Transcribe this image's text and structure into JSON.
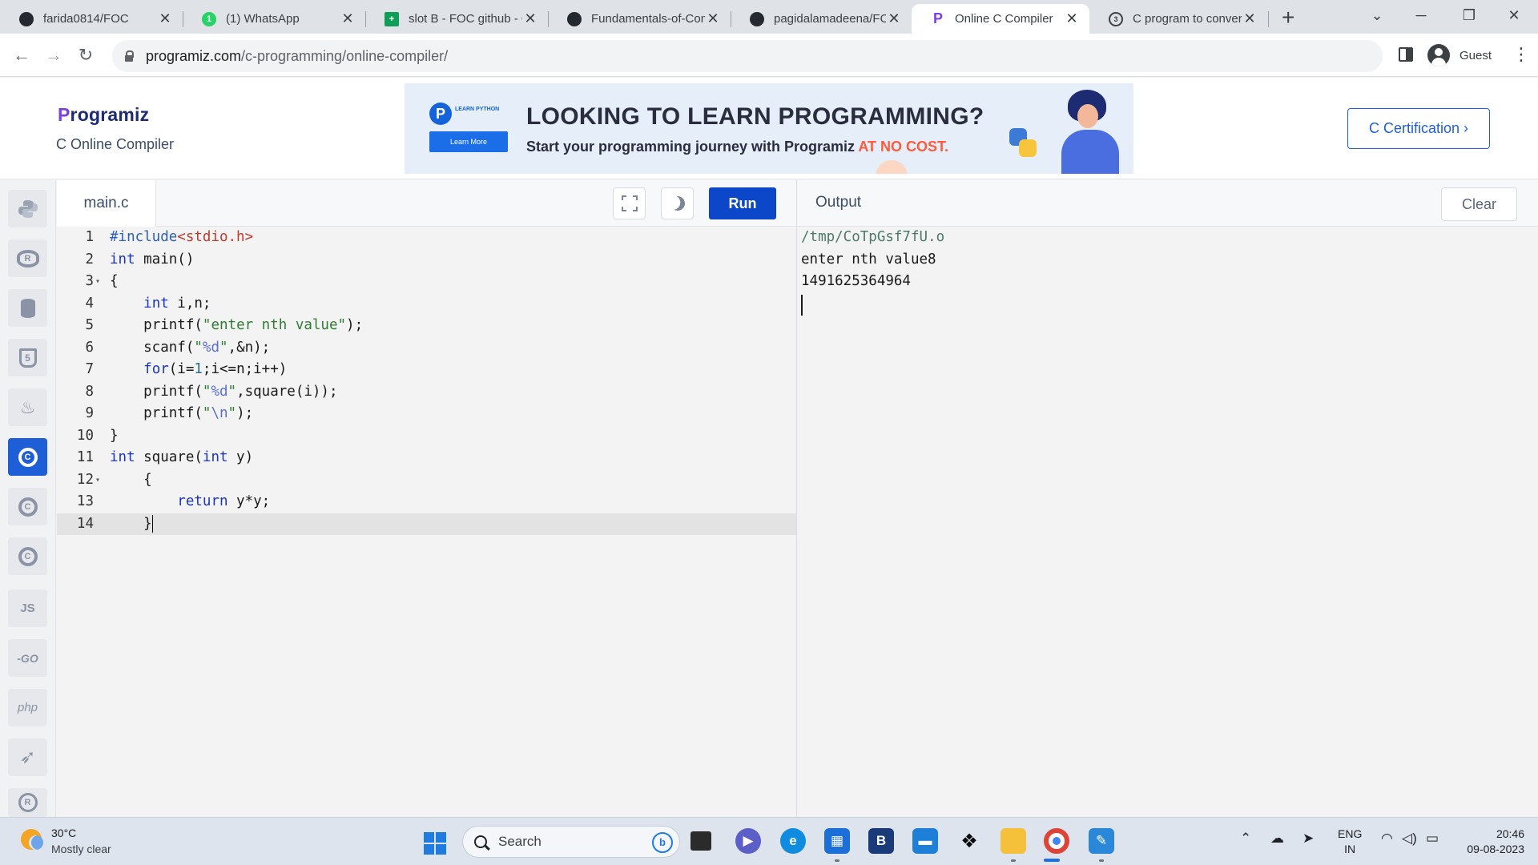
{
  "browser": {
    "tabs": [
      {
        "title": "farida0814/FOC",
        "icon": "github-icon",
        "active": false
      },
      {
        "title": "(1) WhatsApp",
        "icon": "whatsapp-icon",
        "active": false
      },
      {
        "title": "slot B - FOC github - G",
        "icon": "sheets-icon",
        "active": false
      },
      {
        "title": "Fundamentals-of-Com",
        "icon": "github-icon",
        "active": false
      },
      {
        "title": "pagidalamadeena/FOC",
        "icon": "github-icon",
        "active": false
      },
      {
        "title": "Online C Compiler",
        "icon": "programiz-icon",
        "active": true
      },
      {
        "title": "C program to convert",
        "icon": "site-icon",
        "active": false
      }
    ],
    "url_host": "programiz.com",
    "url_path": "/c-programming/online-compiler/",
    "profile_label": "Guest"
  },
  "site": {
    "logo": "rogramiz",
    "logo_p": "P",
    "subtitle": "C Online Compiler",
    "banner": {
      "tag": "LEARN PYTHON",
      "learn_more": "Learn More",
      "headline": "LOOKING TO LEARN PROGRAMMING?",
      "tagline": "Start your programming journey with Programiz ",
      "tagline_highlight": "AT NO COST."
    },
    "cert_button": "C Certification ›"
  },
  "languages": [
    {
      "name": "python-lang-icon",
      "label": ""
    },
    {
      "name": "r-lang-icon",
      "label": "R"
    },
    {
      "name": "sql-lang-icon",
      "label": ""
    },
    {
      "name": "html-lang-icon",
      "label": "5"
    },
    {
      "name": "java-lang-icon",
      "label": "♨"
    },
    {
      "name": "c-lang-icon",
      "label": "C",
      "active": true
    },
    {
      "name": "cpp-lang-icon",
      "label": "C"
    },
    {
      "name": "csharp-lang-icon",
      "label": "C"
    },
    {
      "name": "js-lang-icon",
      "label": "JS"
    },
    {
      "name": "go-lang-icon",
      "label": "-GO"
    },
    {
      "name": "php-lang-icon",
      "label": "php"
    },
    {
      "name": "swift-lang-icon",
      "label": "➶"
    },
    {
      "name": "rust-lang-icon",
      "label": "R"
    }
  ],
  "editor": {
    "filename": "main.c",
    "run_label": "Run",
    "lines": [
      {
        "n": "1",
        "text": "#include<stdio.h>",
        "fold": ""
      },
      {
        "n": "2",
        "text": "int main()",
        "fold": ""
      },
      {
        "n": "3",
        "text": "{",
        "fold": "▾"
      },
      {
        "n": "4",
        "text": "    int i,n;",
        "fold": ""
      },
      {
        "n": "5",
        "text": "    printf(\"enter nth value\");",
        "fold": ""
      },
      {
        "n": "6",
        "text": "    scanf(\"%d\",&n);",
        "fold": ""
      },
      {
        "n": "7",
        "text": "    for(i=1;i<=n;i++)",
        "fold": ""
      },
      {
        "n": "8",
        "text": "    printf(\"%d\",square(i));",
        "fold": ""
      },
      {
        "n": "9",
        "text": "    printf(\"\\n\");",
        "fold": ""
      },
      {
        "n": "10",
        "text": "}",
        "fold": ""
      },
      {
        "n": "11",
        "text": "int square(int y)",
        "fold": ""
      },
      {
        "n": "12",
        "text": "    {",
        "fold": "▾"
      },
      {
        "n": "13",
        "text": "        return y*y;",
        "fold": ""
      },
      {
        "n": "14",
        "text": "    }",
        "fold": "",
        "current": true
      }
    ]
  },
  "output": {
    "title": "Output",
    "clear_label": "Clear",
    "lines": [
      "/tmp/CoTpGsf7fU.o",
      "enter nth value8",
      "1491625364964"
    ]
  },
  "taskbar": {
    "temperature": "30°C",
    "weather": "Mostly clear",
    "search_placeholder": "Search",
    "lang_line1": "ENG",
    "lang_line2": "IN",
    "time": "20:46",
    "date": "09-08-2023"
  },
  "colors": {
    "run_button": "#0d47c9",
    "active_language": "#1e5fd8",
    "accent_text": "#ff5a3c"
  }
}
